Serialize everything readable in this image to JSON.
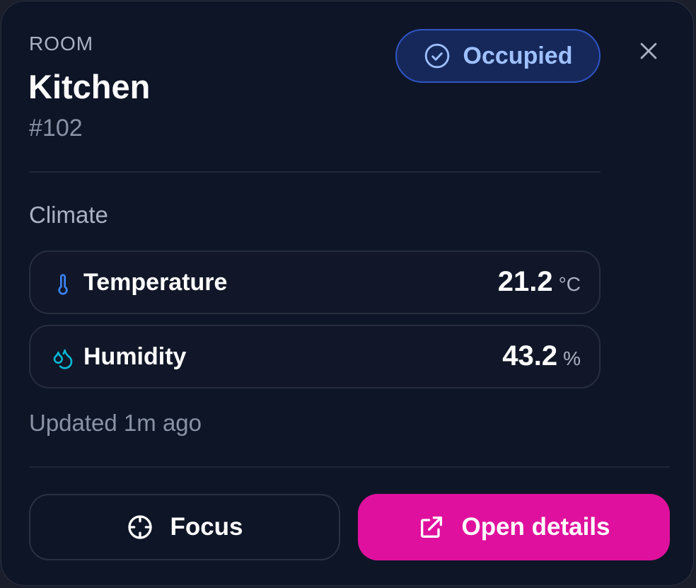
{
  "header": {
    "eyebrow": "ROOM",
    "title": "Kitchen",
    "room_number": "#102"
  },
  "status_badge": {
    "label": "Occupied",
    "icon": "check-circle-icon",
    "color": "#9ec0ff"
  },
  "close_icon": "close-icon",
  "climate": {
    "section_title": "Climate",
    "metrics": [
      {
        "label": "Temperature",
        "value": "21.2",
        "unit": "°C",
        "icon": "thermometer-icon",
        "icon_color": "#3b82f6"
      },
      {
        "label": "Humidity",
        "value": "43.2",
        "unit": "%",
        "icon": "droplets-icon",
        "icon_color": "#06b6d4"
      }
    ]
  },
  "updated_text": "Updated 1m ago",
  "actions": {
    "focus_label": "Focus",
    "focus_icon": "crosshair-icon",
    "open_label": "Open details",
    "open_icon": "external-link-icon",
    "open_color": "#e0109e"
  }
}
